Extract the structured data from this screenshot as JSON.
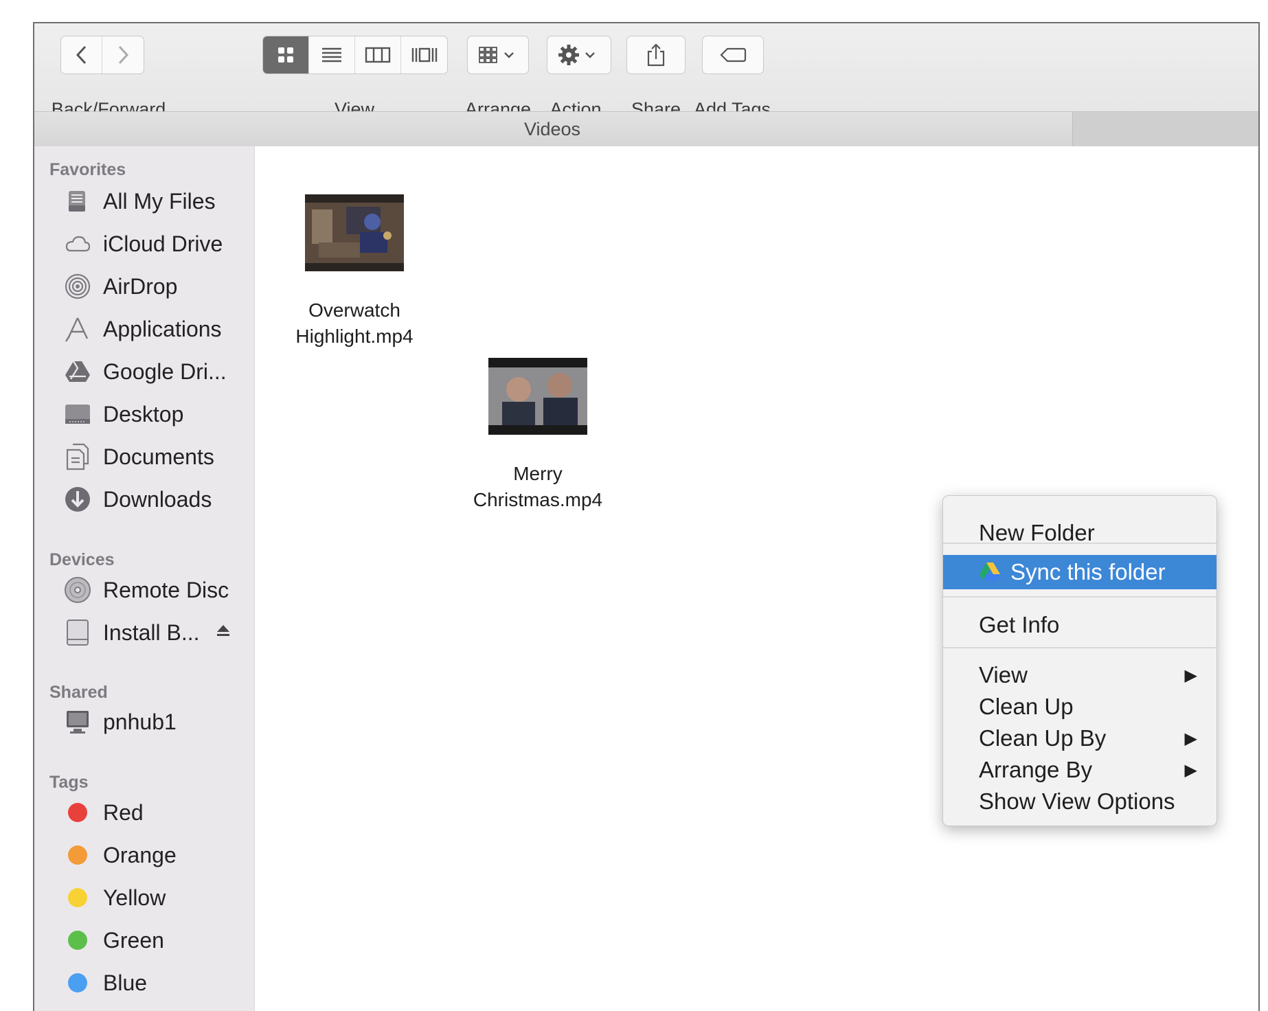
{
  "toolbar": {
    "back_forward_label": "Back/Forward",
    "view_label": "View",
    "arrange_label": "Arrange",
    "action_label": "Action",
    "share_label": "Share",
    "add_tags_label": "Add Tags"
  },
  "path_title": "Videos",
  "sidebar": {
    "favorites_title": "Favorites",
    "favorites": [
      {
        "label": "All My Files",
        "icon": "all-files-icon"
      },
      {
        "label": "iCloud Drive",
        "icon": "cloud-icon"
      },
      {
        "label": "AirDrop",
        "icon": "airdrop-icon"
      },
      {
        "label": "Applications",
        "icon": "applications-icon"
      },
      {
        "label": "Google Dri...",
        "icon": "google-drive-icon"
      },
      {
        "label": "Desktop",
        "icon": "desktop-icon"
      },
      {
        "label": "Documents",
        "icon": "documents-icon"
      },
      {
        "label": "Downloads",
        "icon": "downloads-icon"
      }
    ],
    "devices_title": "Devices",
    "devices": [
      {
        "label": "Remote Disc",
        "icon": "disc-icon"
      },
      {
        "label": "Install B...",
        "icon": "drive-icon"
      }
    ],
    "shared_title": "Shared",
    "shared": [
      {
        "label": "pnhub1",
        "icon": "computer-icon"
      }
    ],
    "tags_title": "Tags",
    "tags": [
      {
        "label": "Red",
        "color": "#e8413c"
      },
      {
        "label": "Orange",
        "color": "#f29b38"
      },
      {
        "label": "Yellow",
        "color": "#f8d234"
      },
      {
        "label": "Green",
        "color": "#5cbf4a"
      },
      {
        "label": "Blue",
        "color": "#4b9ff0"
      }
    ]
  },
  "files": [
    {
      "line1": "Overwatch",
      "line2": "Highlight.mp4"
    },
    {
      "line1": "Merry",
      "line2": "Christmas.mp4"
    }
  ],
  "context_menu": {
    "new_folder": "New Folder",
    "sync_folder": "Sync this folder",
    "get_info": "Get Info",
    "view": "View",
    "clean_up": "Clean Up",
    "clean_up_by": "Clean Up By",
    "arrange_by": "Arrange By",
    "show_view_options": "Show View Options",
    "highlight_color": "#3d87d7"
  }
}
